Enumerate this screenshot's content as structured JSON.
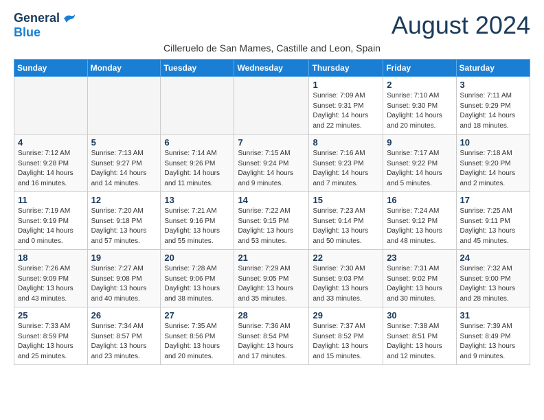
{
  "header": {
    "logo_general": "General",
    "logo_blue": "Blue",
    "month_title": "August 2024",
    "location": "Cilleruelo de San Mames, Castille and Leon, Spain"
  },
  "weekdays": [
    "Sunday",
    "Monday",
    "Tuesday",
    "Wednesday",
    "Thursday",
    "Friday",
    "Saturday"
  ],
  "weeks": [
    [
      {
        "day": "",
        "info": ""
      },
      {
        "day": "",
        "info": ""
      },
      {
        "day": "",
        "info": ""
      },
      {
        "day": "",
        "info": ""
      },
      {
        "day": "1",
        "info": "Sunrise: 7:09 AM\nSunset: 9:31 PM\nDaylight: 14 hours\nand 22 minutes."
      },
      {
        "day": "2",
        "info": "Sunrise: 7:10 AM\nSunset: 9:30 PM\nDaylight: 14 hours\nand 20 minutes."
      },
      {
        "day": "3",
        "info": "Sunrise: 7:11 AM\nSunset: 9:29 PM\nDaylight: 14 hours\nand 18 minutes."
      }
    ],
    [
      {
        "day": "4",
        "info": "Sunrise: 7:12 AM\nSunset: 9:28 PM\nDaylight: 14 hours\nand 16 minutes."
      },
      {
        "day": "5",
        "info": "Sunrise: 7:13 AM\nSunset: 9:27 PM\nDaylight: 14 hours\nand 14 minutes."
      },
      {
        "day": "6",
        "info": "Sunrise: 7:14 AM\nSunset: 9:26 PM\nDaylight: 14 hours\nand 11 minutes."
      },
      {
        "day": "7",
        "info": "Sunrise: 7:15 AM\nSunset: 9:24 PM\nDaylight: 14 hours\nand 9 minutes."
      },
      {
        "day": "8",
        "info": "Sunrise: 7:16 AM\nSunset: 9:23 PM\nDaylight: 14 hours\nand 7 minutes."
      },
      {
        "day": "9",
        "info": "Sunrise: 7:17 AM\nSunset: 9:22 PM\nDaylight: 14 hours\nand 5 minutes."
      },
      {
        "day": "10",
        "info": "Sunrise: 7:18 AM\nSunset: 9:20 PM\nDaylight: 14 hours\nand 2 minutes."
      }
    ],
    [
      {
        "day": "11",
        "info": "Sunrise: 7:19 AM\nSunset: 9:19 PM\nDaylight: 14 hours\nand 0 minutes."
      },
      {
        "day": "12",
        "info": "Sunrise: 7:20 AM\nSunset: 9:18 PM\nDaylight: 13 hours\nand 57 minutes."
      },
      {
        "day": "13",
        "info": "Sunrise: 7:21 AM\nSunset: 9:16 PM\nDaylight: 13 hours\nand 55 minutes."
      },
      {
        "day": "14",
        "info": "Sunrise: 7:22 AM\nSunset: 9:15 PM\nDaylight: 13 hours\nand 53 minutes."
      },
      {
        "day": "15",
        "info": "Sunrise: 7:23 AM\nSunset: 9:14 PM\nDaylight: 13 hours\nand 50 minutes."
      },
      {
        "day": "16",
        "info": "Sunrise: 7:24 AM\nSunset: 9:12 PM\nDaylight: 13 hours\nand 48 minutes."
      },
      {
        "day": "17",
        "info": "Sunrise: 7:25 AM\nSunset: 9:11 PM\nDaylight: 13 hours\nand 45 minutes."
      }
    ],
    [
      {
        "day": "18",
        "info": "Sunrise: 7:26 AM\nSunset: 9:09 PM\nDaylight: 13 hours\nand 43 minutes."
      },
      {
        "day": "19",
        "info": "Sunrise: 7:27 AM\nSunset: 9:08 PM\nDaylight: 13 hours\nand 40 minutes."
      },
      {
        "day": "20",
        "info": "Sunrise: 7:28 AM\nSunset: 9:06 PM\nDaylight: 13 hours\nand 38 minutes."
      },
      {
        "day": "21",
        "info": "Sunrise: 7:29 AM\nSunset: 9:05 PM\nDaylight: 13 hours\nand 35 minutes."
      },
      {
        "day": "22",
        "info": "Sunrise: 7:30 AM\nSunset: 9:03 PM\nDaylight: 13 hours\nand 33 minutes."
      },
      {
        "day": "23",
        "info": "Sunrise: 7:31 AM\nSunset: 9:02 PM\nDaylight: 13 hours\nand 30 minutes."
      },
      {
        "day": "24",
        "info": "Sunrise: 7:32 AM\nSunset: 9:00 PM\nDaylight: 13 hours\nand 28 minutes."
      }
    ],
    [
      {
        "day": "25",
        "info": "Sunrise: 7:33 AM\nSunset: 8:59 PM\nDaylight: 13 hours\nand 25 minutes."
      },
      {
        "day": "26",
        "info": "Sunrise: 7:34 AM\nSunset: 8:57 PM\nDaylight: 13 hours\nand 23 minutes."
      },
      {
        "day": "27",
        "info": "Sunrise: 7:35 AM\nSunset: 8:56 PM\nDaylight: 13 hours\nand 20 minutes."
      },
      {
        "day": "28",
        "info": "Sunrise: 7:36 AM\nSunset: 8:54 PM\nDaylight: 13 hours\nand 17 minutes."
      },
      {
        "day": "29",
        "info": "Sunrise: 7:37 AM\nSunset: 8:52 PM\nDaylight: 13 hours\nand 15 minutes."
      },
      {
        "day": "30",
        "info": "Sunrise: 7:38 AM\nSunset: 8:51 PM\nDaylight: 13 hours\nand 12 minutes."
      },
      {
        "day": "31",
        "info": "Sunrise: 7:39 AM\nSunset: 8:49 PM\nDaylight: 13 hours\nand 9 minutes."
      }
    ]
  ]
}
